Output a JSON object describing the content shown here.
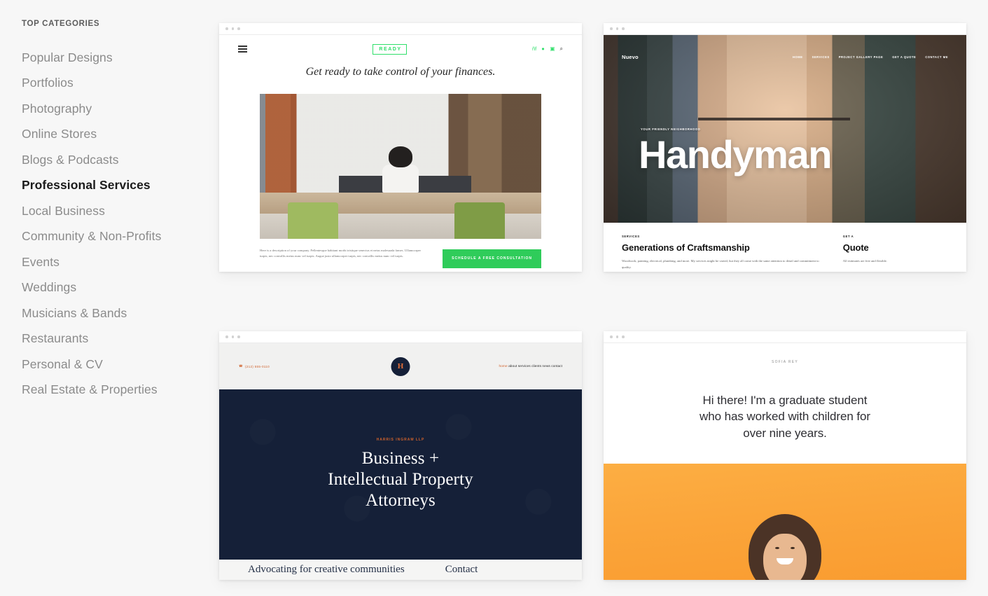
{
  "sidebar": {
    "title": "TOP CATEGORIES",
    "items": [
      {
        "label": "Popular Designs",
        "active": false
      },
      {
        "label": "Portfolios",
        "active": false
      },
      {
        "label": "Photography",
        "active": false
      },
      {
        "label": "Online Stores",
        "active": false
      },
      {
        "label": "Blogs & Podcasts",
        "active": false
      },
      {
        "label": "Professional Services",
        "active": true
      },
      {
        "label": "Local Business",
        "active": false
      },
      {
        "label": "Community & Non-Profits",
        "active": false
      },
      {
        "label": "Events",
        "active": false
      },
      {
        "label": "Weddings",
        "active": false
      },
      {
        "label": "Musicians & Bands",
        "active": false
      },
      {
        "label": "Restaurants",
        "active": false
      },
      {
        "label": "Personal & CV",
        "active": false
      },
      {
        "label": "Real Estate & Properties",
        "active": false
      }
    ]
  },
  "colors": {
    "page_background": "#f7f7f7",
    "card_background": "#ffffff",
    "active_text": "#1c1c1c",
    "muted_text": "#8b8b8b",
    "ready_green": "#2fdf6a",
    "ready_button_green": "#2fcc5a",
    "law_navy": "#152038",
    "law_orange": "#d0622c",
    "sofia_orange": "#fba83c"
  },
  "templates": [
    {
      "id": "ready",
      "logo": "READY",
      "menu_icon": "hamburger-icon",
      "social": [
        "facebook-icon",
        "twitter-icon",
        "instagram-icon",
        "search-icon"
      ],
      "tagline": "Get ready to take control of your finances.",
      "hero_image_alt": "Woman smiling at a wooden conference table in a brick office",
      "body_copy": "Here is a description of your company. Pellentesque habitant morbi tristique senectus et netus malesuada fames. Ullamcorper turpis, nec convallis metus nunc vel turpis. Augue justo ullamcorper turpis, nec convallis metus nunc vel turpis.",
      "cta": "SCHEDULE A FREE CONSULTATION"
    },
    {
      "id": "nuevo-handyman",
      "logo": "Nuevo",
      "nav": [
        "HOME",
        "SERVICES",
        "PROJECT GALLERY PAGE",
        "GET A QUOTE",
        "CONTACT ME"
      ],
      "eyebrow": "YOUR FRIENDLY NEIGHBORHOOD",
      "title": "Handyman",
      "hero_image_alt": "Close-up of a handyman wearing a canvas apron with hands in pockets",
      "columns": [
        {
          "kicker": "SERVICES",
          "heading": "Generations of Craftsmanship",
          "text": "Woodwork, painting, electrical, plumbing, and more. My services might be varied, but they all come with the same attention to detail and commitment to quality."
        },
        {
          "kicker": "GET A",
          "heading": "Quote",
          "text": "All estimates are free and flexible."
        }
      ]
    },
    {
      "id": "harris-ingram",
      "phone_icon": "phone-icon",
      "phone": "(212) 555-0110",
      "badge_monogram": "H",
      "nav_active": "home",
      "nav": [
        "about",
        "services",
        "clients",
        "news",
        "contact"
      ],
      "eyebrow": "HARRIS INGRAM LLP",
      "title_lines": [
        "Business +",
        "Intellectual Property",
        "Attorneys"
      ],
      "footer_items": [
        "Advocating for creative communities",
        "Contact"
      ]
    },
    {
      "id": "sofia-rey",
      "name": "SOFIA REY",
      "intro_lines": [
        "Hi there! I'm a graduate student",
        "who has worked with children for",
        "over nine years."
      ],
      "hero_image_alt": "Smiling woman in front of an orange background"
    }
  ]
}
